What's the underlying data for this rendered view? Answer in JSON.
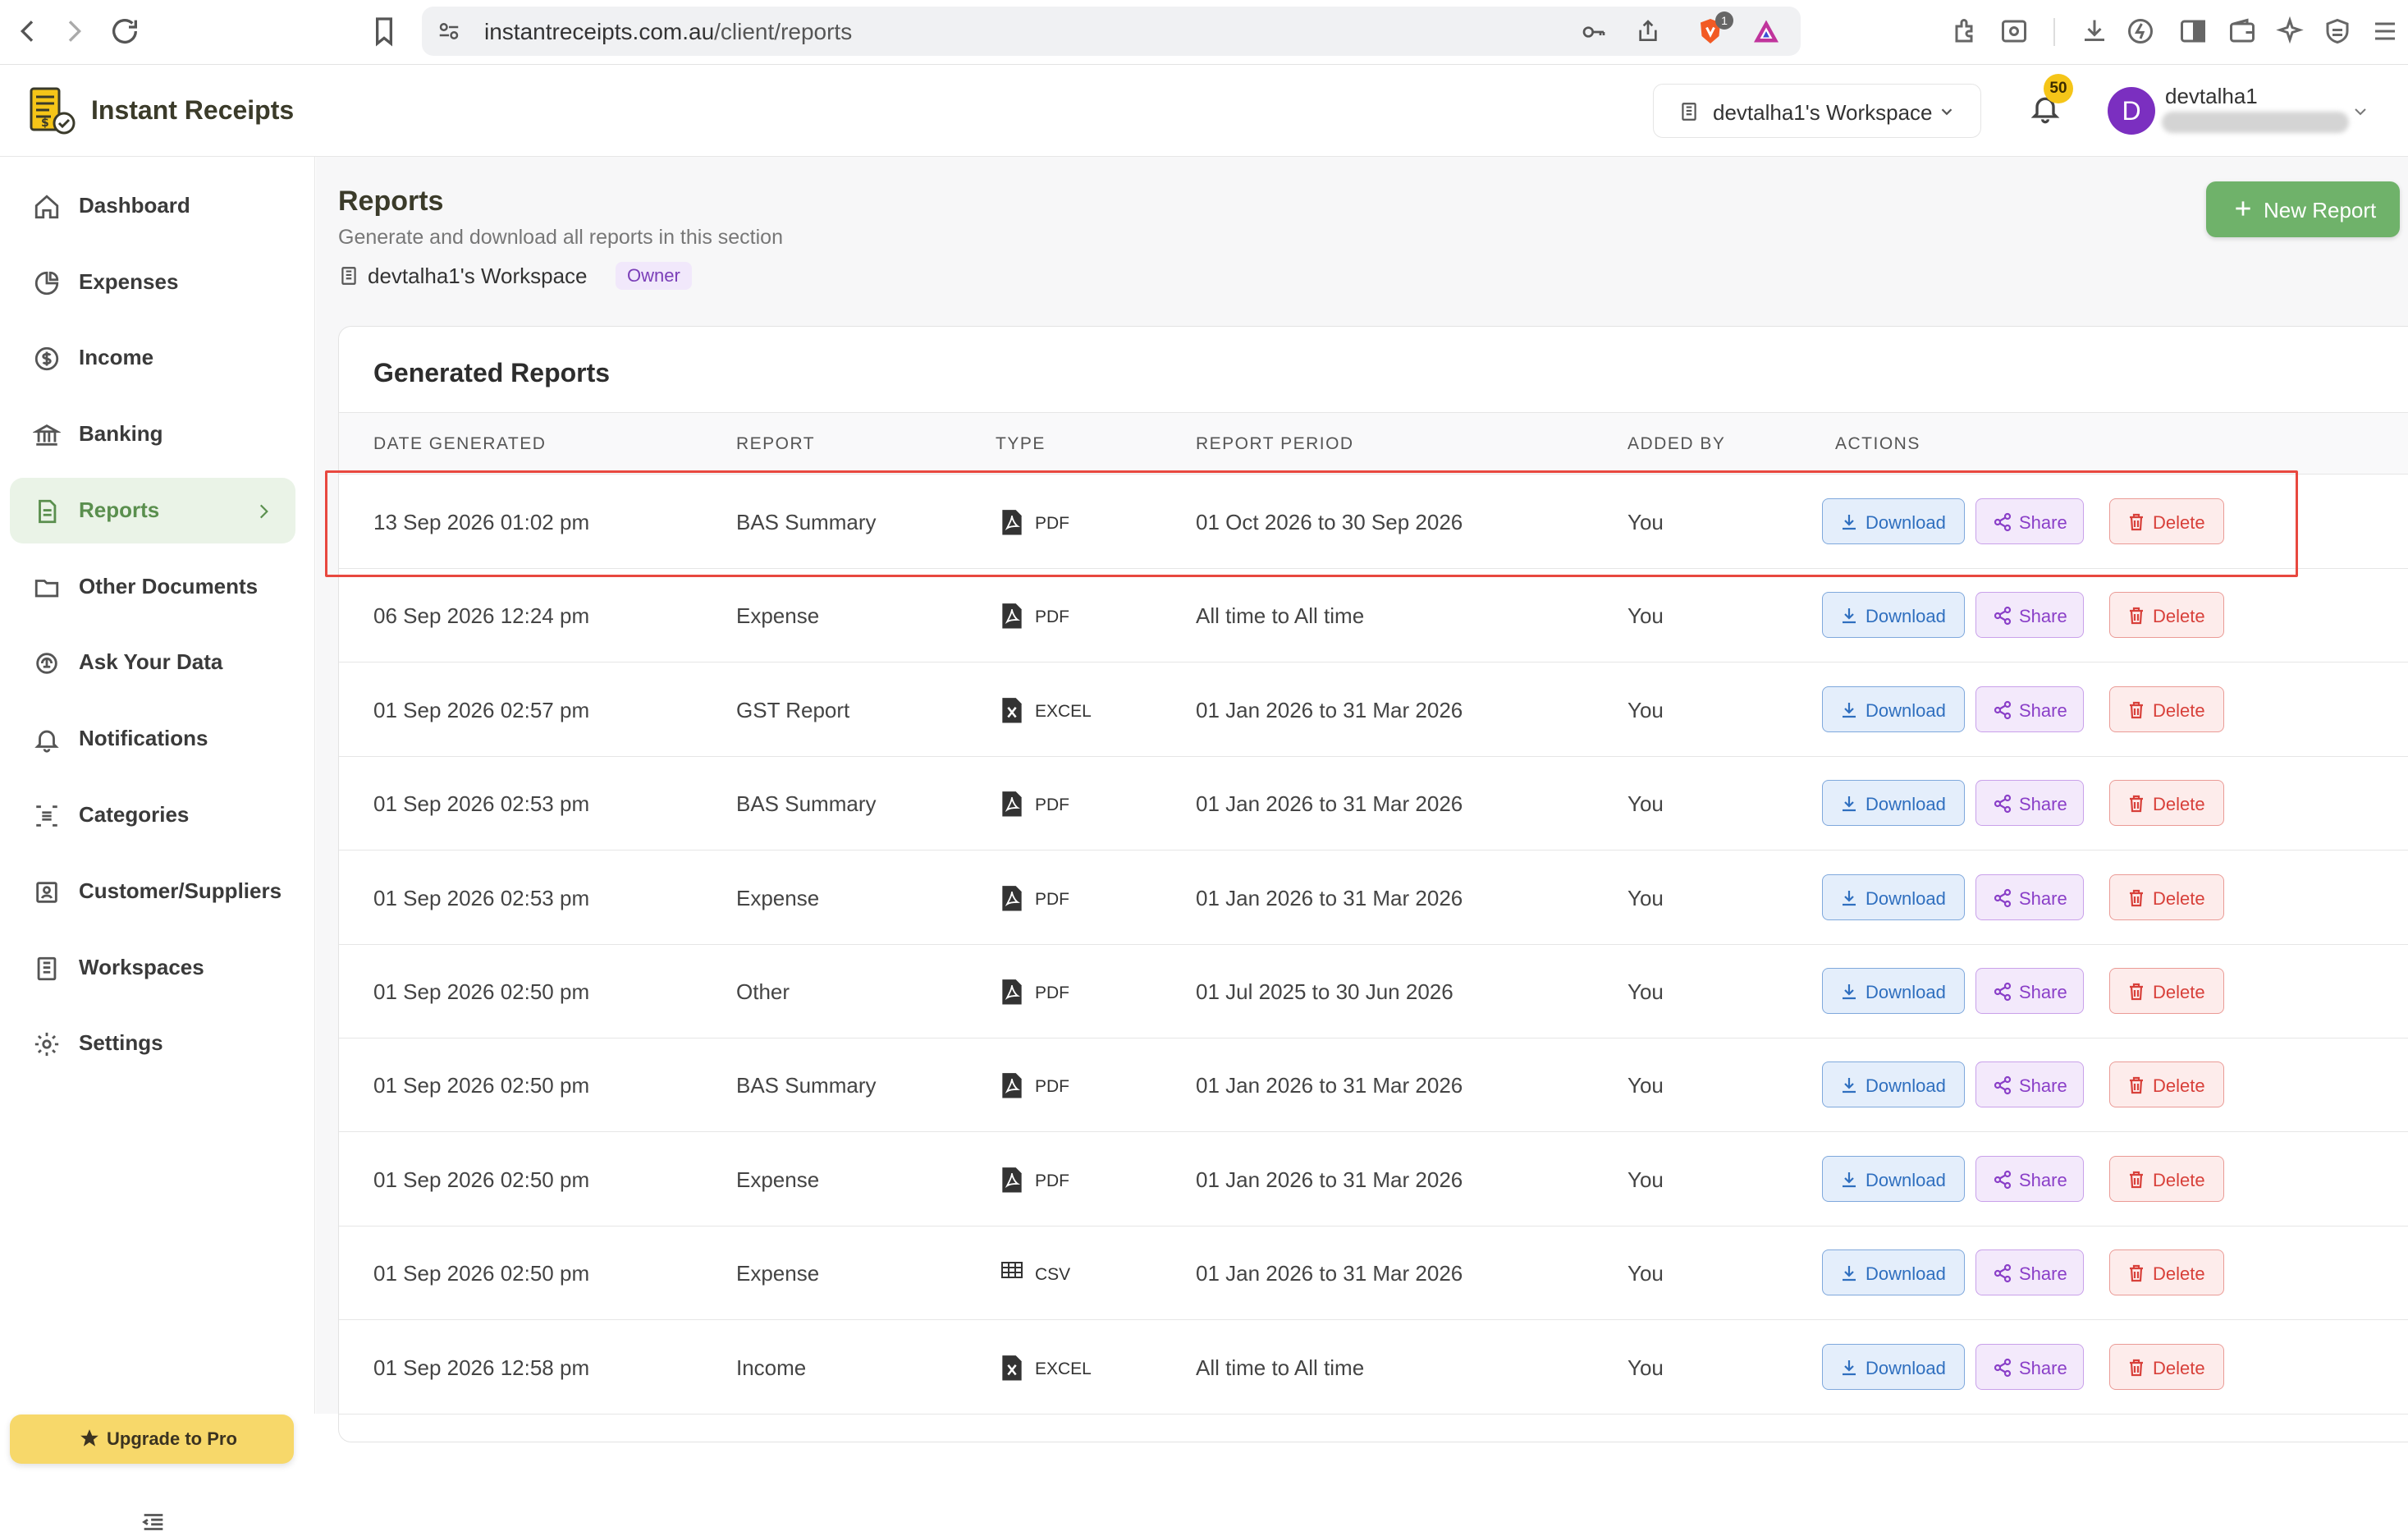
{
  "browser": {
    "url_host": "instantreceipts.com.au",
    "url_path": "/client/reports",
    "extension_badge": "1"
  },
  "header": {
    "brand": "Instant Receipts",
    "workspace_selector": "devtalha1's Workspace",
    "notification_count": "50",
    "avatar_initial": "D",
    "user_name": "devtalha1"
  },
  "sidebar": {
    "items": [
      {
        "label": "Dashboard",
        "icon": "home-icon"
      },
      {
        "label": "Expenses",
        "icon": "pie-chart-icon"
      },
      {
        "label": "Income",
        "icon": "dollar-circle-icon"
      },
      {
        "label": "Banking",
        "icon": "bank-icon"
      },
      {
        "label": "Reports",
        "icon": "file-icon",
        "active": true
      },
      {
        "label": "Other Documents",
        "icon": "folder-icon"
      },
      {
        "label": "Ask Your Data",
        "icon": "ai-icon"
      },
      {
        "label": "Notifications",
        "icon": "bell-icon"
      },
      {
        "label": "Categories",
        "icon": "list-icon"
      },
      {
        "label": "Customer/Suppliers",
        "icon": "contacts-icon"
      },
      {
        "label": "Workspaces",
        "icon": "building-icon"
      },
      {
        "label": "Settings",
        "icon": "gear-icon"
      }
    ],
    "upgrade": "Upgrade to Pro"
  },
  "page": {
    "title": "Reports",
    "subtitle": "Generate and download all reports in this section",
    "workspace": "devtalha1's Workspace",
    "role_badge": "Owner",
    "new_report_label": "New Report"
  },
  "table": {
    "title": "Generated Reports",
    "columns": [
      "DATE GENERATED",
      "REPORT",
      "TYPE",
      "REPORT PERIOD",
      "ADDED BY",
      "ACTIONS"
    ],
    "actions": {
      "download": "Download",
      "share": "Share",
      "delete": "Delete"
    },
    "rows": [
      {
        "date": "13 Sep 2026 01:02 pm",
        "report": "BAS Summary",
        "type": "PDF",
        "period": "01 Oct 2026 to 30 Sep 2026",
        "added_by": "You"
      },
      {
        "date": "06 Sep 2026 12:24 pm",
        "report": "Expense",
        "type": "PDF",
        "period": "All time to All time",
        "added_by": "You"
      },
      {
        "date": "01 Sep 2026 02:57 pm",
        "report": "GST Report",
        "type": "EXCEL",
        "period": "01 Jan 2026 to 31 Mar 2026",
        "added_by": "You"
      },
      {
        "date": "01 Sep 2026 02:53 pm",
        "report": "BAS Summary",
        "type": "PDF",
        "period": "01 Jan 2026 to 31 Mar 2026",
        "added_by": "You"
      },
      {
        "date": "01 Sep 2026 02:53 pm",
        "report": "Expense",
        "type": "PDF",
        "period": "01 Jan 2026 to 31 Mar 2026",
        "added_by": "You"
      },
      {
        "date": "01 Sep 2026 02:50 pm",
        "report": "Other",
        "type": "PDF",
        "period": "01 Jul 2025 to 30 Jun 2026",
        "added_by": "You"
      },
      {
        "date": "01 Sep 2026 02:50 pm",
        "report": "BAS Summary",
        "type": "PDF",
        "period": "01 Jan 2026 to 31 Mar 2026",
        "added_by": "You"
      },
      {
        "date": "01 Sep 2026 02:50 pm",
        "report": "Expense",
        "type": "PDF",
        "period": "01 Jan 2026 to 31 Mar 2026",
        "added_by": "You"
      },
      {
        "date": "01 Sep 2026 02:50 pm",
        "report": "Expense",
        "type": "CSV",
        "period": "01 Jan 2026 to 31 Mar 2026",
        "added_by": "You"
      },
      {
        "date": "01 Sep 2026 12:58 pm",
        "report": "Income",
        "type": "EXCEL",
        "period": "All time to All time",
        "added_by": "You"
      }
    ]
  },
  "colors": {
    "accent_green": "#6fb26a",
    "download_blue": "#2f6fbf",
    "share_purple": "#8a3fc8",
    "delete_red": "#d8403a",
    "highlight_red": "#e8483f"
  }
}
